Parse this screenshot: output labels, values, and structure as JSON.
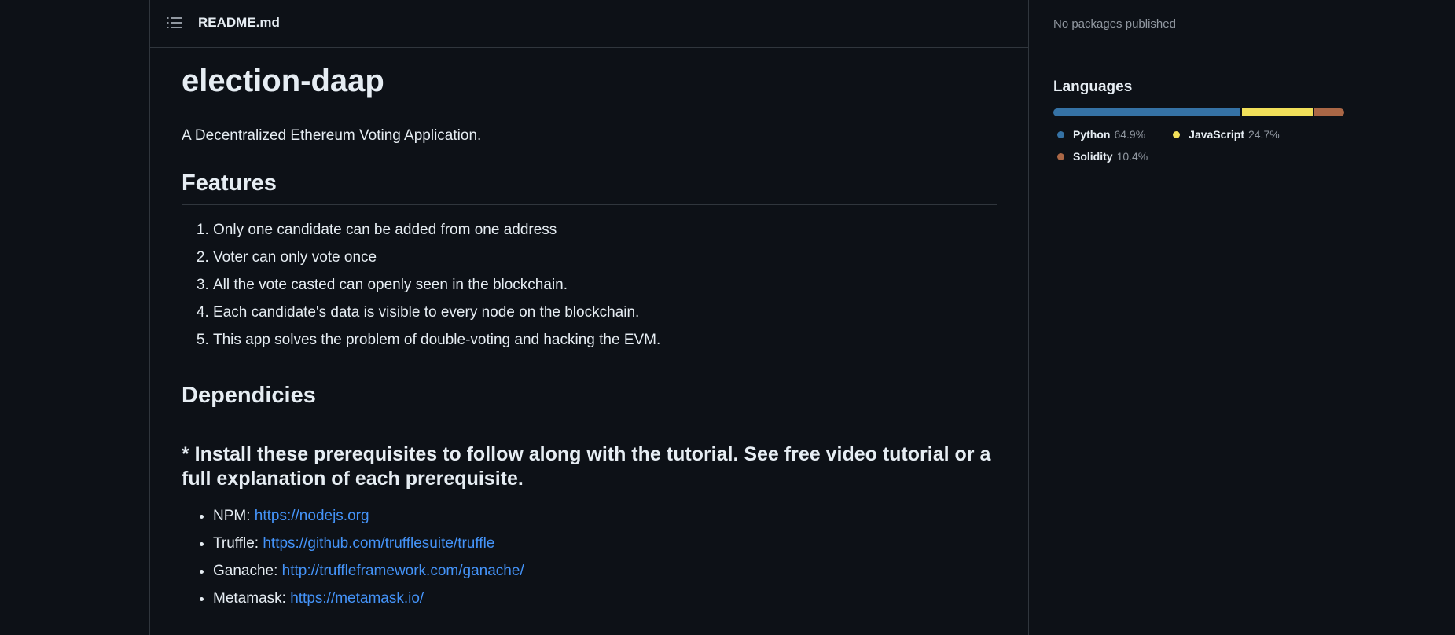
{
  "readme": {
    "filename": "README.md",
    "title": "election-daap",
    "description": "A Decentralized Ethereum Voting Application.",
    "features_heading": "Features",
    "features": [
      "Only one candidate can be added from one address",
      "Voter can only vote once",
      "All the vote casted can openly seen in the blockchain.",
      "Each candidate's data is visible to every node on the blockchain.",
      "This app solves the problem of double-voting and hacking the EVM."
    ],
    "dependencies_heading": "Dependicies",
    "prereq_text": "* Install these prerequisites to follow along with the tutorial. See free video tutorial or a full explanation of each prerequisite.",
    "dependencies": [
      {
        "label": "NPM: ",
        "link": "https://nodejs.org"
      },
      {
        "label": "Truffle: ",
        "link": "https://github.com/trufflesuite/truffle"
      },
      {
        "label": "Ganache: ",
        "link": "http://truffleframework.com/ganache/"
      },
      {
        "label": "Metamask: ",
        "link": "https://metamask.io/"
      }
    ]
  },
  "sidebar": {
    "packages_text": "No packages published",
    "languages_heading": "Languages",
    "languages": [
      {
        "name": "Python",
        "percent": "64.9%",
        "value": 64.9,
        "color": "#3572A5"
      },
      {
        "name": "JavaScript",
        "percent": "24.7%",
        "value": 24.7,
        "color": "#f1e05a"
      },
      {
        "name": "Solidity",
        "percent": "10.4%",
        "value": 10.4,
        "color": "#AA6746"
      }
    ]
  },
  "icons": {
    "toc": "list-unordered-icon"
  },
  "colors": {
    "background": "#0d1117",
    "border": "#30363d",
    "text": "#e6edf3",
    "muted": "#9198a1",
    "link": "#4493f8"
  }
}
